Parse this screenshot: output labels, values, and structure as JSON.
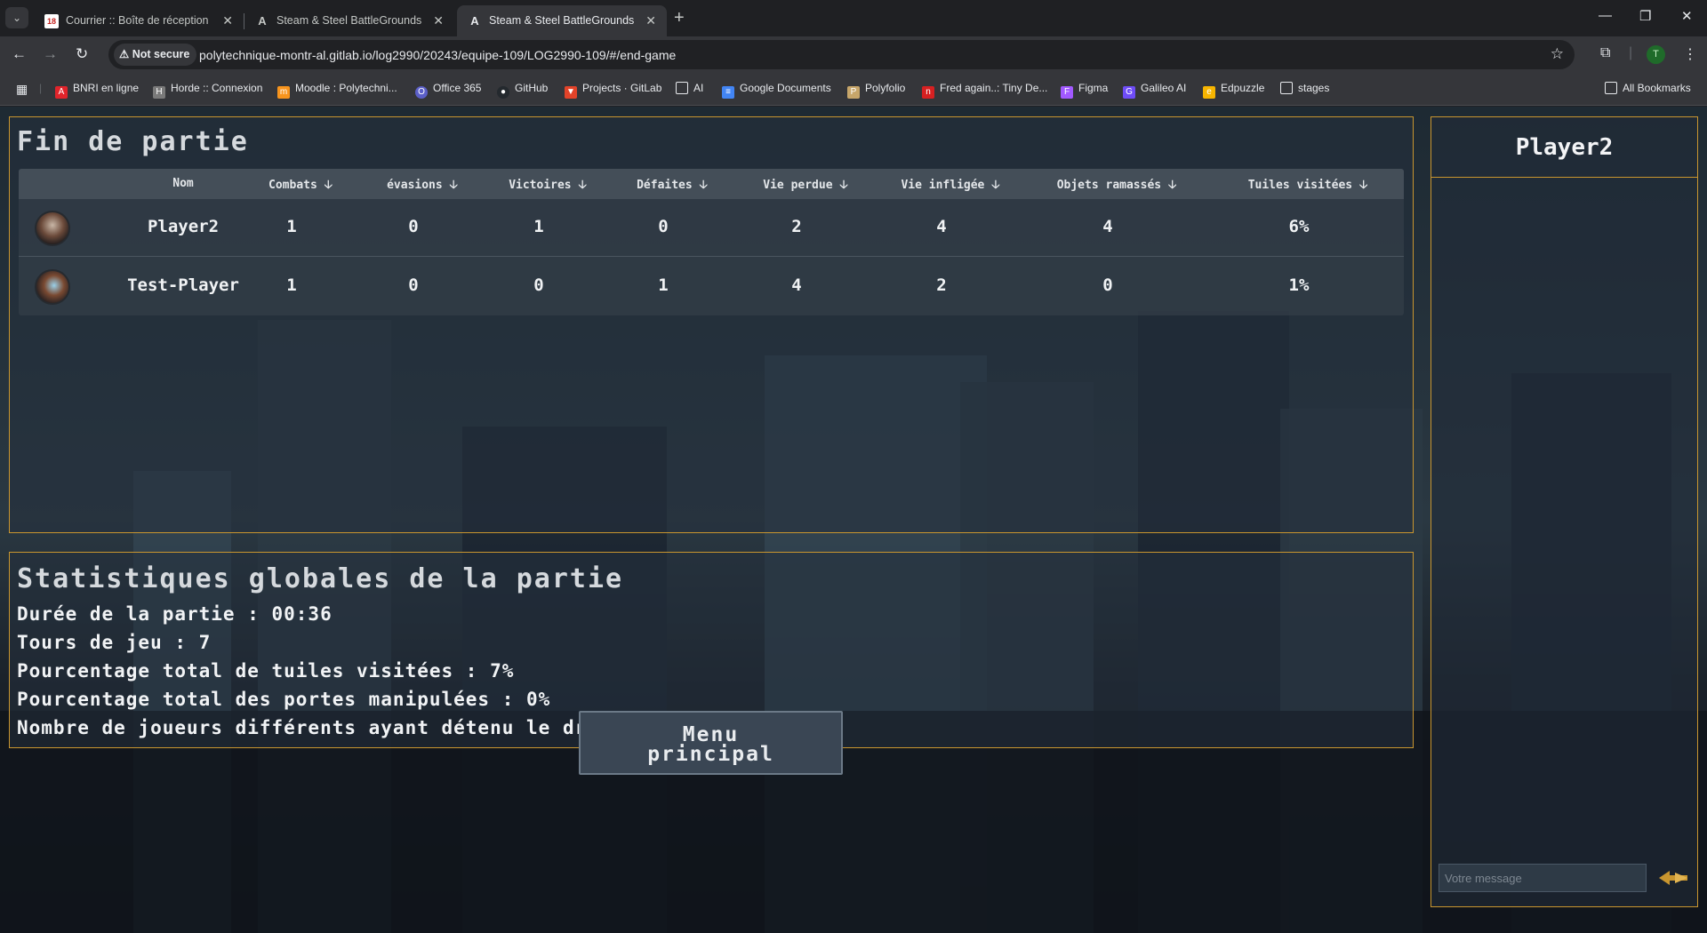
{
  "browser": {
    "tabs": [
      {
        "title": "Courrier :: Boîte de réception",
        "favicon": "mail-icon",
        "badge": "18"
      },
      {
        "title": "Steam & Steel BattleGrounds",
        "favicon": "angular-icon"
      },
      {
        "title": "Steam & Steel BattleGrounds",
        "favicon": "angular-icon",
        "active": true
      }
    ],
    "security_label": "Not secure",
    "url": "polytechnique-montr-al.gitlab.io/log2990/20243/equipe-109/LOG2990-109/#/end-game",
    "profile_initial": "T",
    "bookmarks": [
      {
        "label": "BNRI en ligne",
        "icon": "bnri-icon",
        "color": "#e0242b"
      },
      {
        "label": "Horde :: Connexion",
        "icon": "horde-icon",
        "color": "#7a7a7a"
      },
      {
        "label": "Moodle : Polytechni...",
        "icon": "moodle-icon",
        "color": "#f7941d"
      },
      {
        "label": "Office 365",
        "icon": "office-icon",
        "color": "#5b5fc7"
      },
      {
        "label": "GitHub",
        "icon": "github-icon",
        "color": "#24292e"
      },
      {
        "label": "Projects · GitLab",
        "icon": "gitlab-icon",
        "color": "#e24329"
      },
      {
        "label": "AI",
        "icon": "folder-icon",
        "color": "#35363a"
      },
      {
        "label": "Google Documents",
        "icon": "docs-icon",
        "color": "#4285f4"
      },
      {
        "label": "Polyfolio",
        "icon": "polyfolio-icon",
        "color": "#c7a66a"
      },
      {
        "label": "Fred again..: Tiny De...",
        "icon": "npr-icon",
        "color": "#d62021"
      },
      {
        "label": "Figma",
        "icon": "figma-icon",
        "color": "#a259ff"
      },
      {
        "label": "Galileo AI",
        "icon": "galileo-icon",
        "color": "#6e4cf7"
      },
      {
        "label": "Edpuzzle",
        "icon": "edpuzzle-icon",
        "color": "#f7b500"
      },
      {
        "label": "stages",
        "icon": "folder-icon",
        "color": "#35363a"
      }
    ],
    "all_bookmarks_label": "All Bookmarks"
  },
  "end_game": {
    "title": "Fin de partie",
    "columns": [
      "Nom",
      "Combats",
      "évasions",
      "Victoires",
      "Défaites",
      "Vie perdue",
      "Vie infligée",
      "Objets ramassés",
      "Tuiles visitées"
    ],
    "sort_glyph": "🡣",
    "rows": [
      {
        "name": "Player2",
        "combats": "1",
        "evasions": "0",
        "victoires": "1",
        "defaites": "0",
        "vie_perdue": "2",
        "vie_infligee": "4",
        "objets": "4",
        "tuiles": "6%"
      },
      {
        "name": "Test-Player",
        "combats": "1",
        "evasions": "0",
        "victoires": "0",
        "defaites": "1",
        "vie_perdue": "4",
        "vie_infligee": "2",
        "objets": "0",
        "tuiles": "1%"
      }
    ]
  },
  "global_stats": {
    "title": "Statistiques globales de la partie",
    "lines": [
      "Durée de la partie : 00:36",
      "Tours de jeu : 7",
      "Pourcentage total de tuiles visitées : 7%",
      "Pourcentage total des portes manipulées : 0%",
      "Nombre de joueurs différents ayant détenu le drapeau : 1"
    ]
  },
  "menu_button": {
    "line1": "Menu",
    "line2": "principal"
  },
  "chat": {
    "player_name": "Player2",
    "input_placeholder": "Votre message"
  },
  "colors": {
    "panel_border": "#c9962f",
    "background": "#25323c"
  }
}
